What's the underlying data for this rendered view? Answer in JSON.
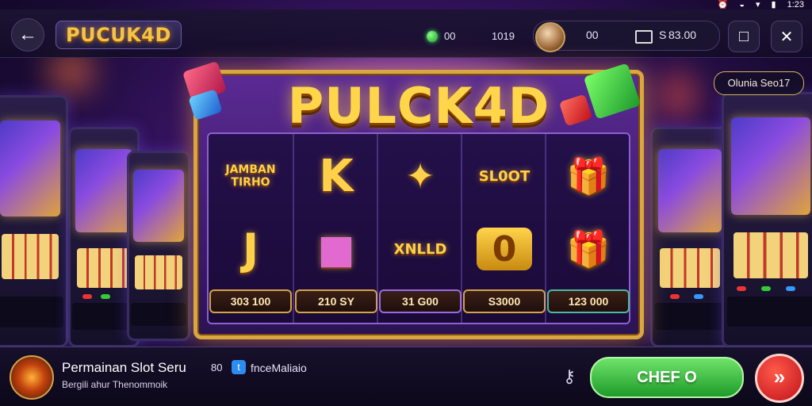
{
  "status_bar": {
    "time": "1:23",
    "icons": [
      "alarm-icon",
      "wifi-icon",
      "signal-icon",
      "battery-icon"
    ]
  },
  "header": {
    "back_icon": "←",
    "brand": "PUCUK4D",
    "gems": "00",
    "level": "1019",
    "coins_left": "00",
    "coins_balance": "83.00",
    "balance_prefix": "S",
    "stop_icon": "□",
    "tools_icon": "✕"
  },
  "side_chip": "Olunia Seo17",
  "slot": {
    "title": "PULCK4D",
    "columns": [
      {
        "top": "JAMBAN\nTIRHO",
        "mid": "J",
        "amount": "303 100"
      },
      {
        "top": "K",
        "mid": "■",
        "amount": "210 SY"
      },
      {
        "top": "✦",
        "mid": "XNLLD",
        "amount": "31 G00"
      },
      {
        "top": "SL0OT",
        "mid": "0",
        "amount": "S3000"
      },
      {
        "top": "🎁",
        "mid": "🎁",
        "amount": "123 000"
      }
    ]
  },
  "footer": {
    "title": "Permainan Slot Seru",
    "subtitle": "Bergili ahur Thenommoik",
    "count": "80",
    "handle": "fnceMaliaio",
    "play_label": "CHEF O",
    "next_icon": "»",
    "key_icon": "⚷"
  },
  "colors": {
    "accent_gold": "#d9a640",
    "play_green": "#1e9b2a",
    "next_red": "#c0101a"
  }
}
